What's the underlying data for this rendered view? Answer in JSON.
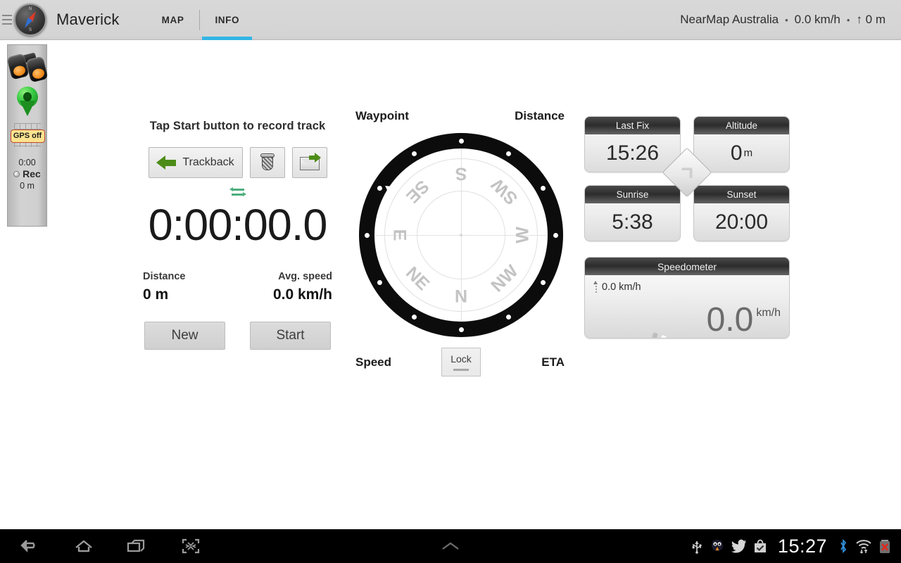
{
  "actionbar": {
    "app_title": "Maverick",
    "logo_icon": "compass-icon",
    "drawer_icon": "menu-icon",
    "tabs": [
      {
        "label": "MAP",
        "active": false
      },
      {
        "label": "INFO",
        "active": true
      }
    ],
    "active_tab_color": "#33b5e5",
    "status": {
      "map_source": "NearMap Australia",
      "separator": "•",
      "speed": "0.0 km/h",
      "altitude": "↑ 0 m"
    }
  },
  "side_widget": {
    "binoculars_icon": "binoculars-icon",
    "pin_icon": "map-pin-icon",
    "gps_badge": "GPS off",
    "grid_icon": "grid-icon",
    "time": "0:00",
    "rec_label": "Rec",
    "distance": "0 m"
  },
  "track_panel": {
    "hint": "Tap Start button to record track",
    "trackback_label": "Trackback",
    "trackback_icon": "arrow-left-icon",
    "delete_icon": "trash-icon",
    "share_icon": "send-mail-icon",
    "swap_icon": "swap-units-icon",
    "timer": "0:00:00.0",
    "stats": [
      {
        "caption": "Distance",
        "value": "0 m"
      },
      {
        "caption": "Avg. speed",
        "value": "0.0 km/h"
      }
    ],
    "new_label": "New",
    "start_label": "Start"
  },
  "compass": {
    "labels": {
      "top_left": "Waypoint",
      "top_right": "Distance",
      "bottom_left": "Speed",
      "bottom_right": "ETA"
    },
    "lock_label": "Lock",
    "heading_deg": 180,
    "cardinals": [
      "N",
      "NE",
      "E",
      "SE",
      "S",
      "SW",
      "W",
      "NW"
    ],
    "ring_dot_count": 12,
    "ring_color": "#0c0c0c"
  },
  "tiles": [
    {
      "caption": "Last Fix",
      "value": "15:26",
      "unit": ""
    },
    {
      "caption": "Altitude",
      "value": "0",
      "unit": "m"
    },
    {
      "caption": "Sunrise",
      "value": "5:38",
      "unit": ""
    },
    {
      "caption": "Sunset",
      "value": "20:00",
      "unit": ""
    }
  ],
  "tile_center_icon": "chevron-right-icon",
  "speedometer": {
    "caption": "Speedometer",
    "max_speed": "0.0 km/h",
    "max_icon": "up-arrow-icon",
    "value": "0.0",
    "unit": "km/h",
    "tick_count": 22
  },
  "system_bar": {
    "nav": [
      {
        "name": "back-icon"
      },
      {
        "name": "home-icon"
      },
      {
        "name": "recents-icon"
      },
      {
        "name": "screenshot-icon"
      }
    ],
    "notifications_icon": "chevron-up-icon",
    "clock": "15:27",
    "status_icons": [
      {
        "name": "usb-icon"
      },
      {
        "name": "twitter-bird-icon"
      },
      {
        "name": "twitter-icon"
      },
      {
        "name": "play-store-icon"
      },
      {
        "name": "bluetooth-icon"
      },
      {
        "name": "wifi-icon"
      },
      {
        "name": "battery-error-icon"
      }
    ]
  }
}
